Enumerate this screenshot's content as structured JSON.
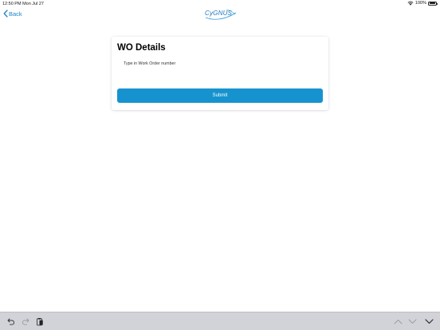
{
  "status_bar": {
    "time_date": "12:50 PM   Mon Jul 27",
    "battery": "100%"
  },
  "nav": {
    "back_label": "Back",
    "logo_text": "CyGNUS"
  },
  "form": {
    "title": "WO Details",
    "input_placeholder": "Type in Work Order number",
    "input_value": "",
    "submit_label": "Submit"
  },
  "colors": {
    "accent": "#1a84c8",
    "submit_bg": "#1693cf",
    "shortcut_bar_bg": "#d1d3d9"
  },
  "shortcut_bar": {
    "icons": [
      "undo-icon",
      "redo-icon",
      "paste-icon",
      "chevron-up-icon",
      "chevron-down-icon",
      "dismiss-keyboard-icon"
    ]
  }
}
